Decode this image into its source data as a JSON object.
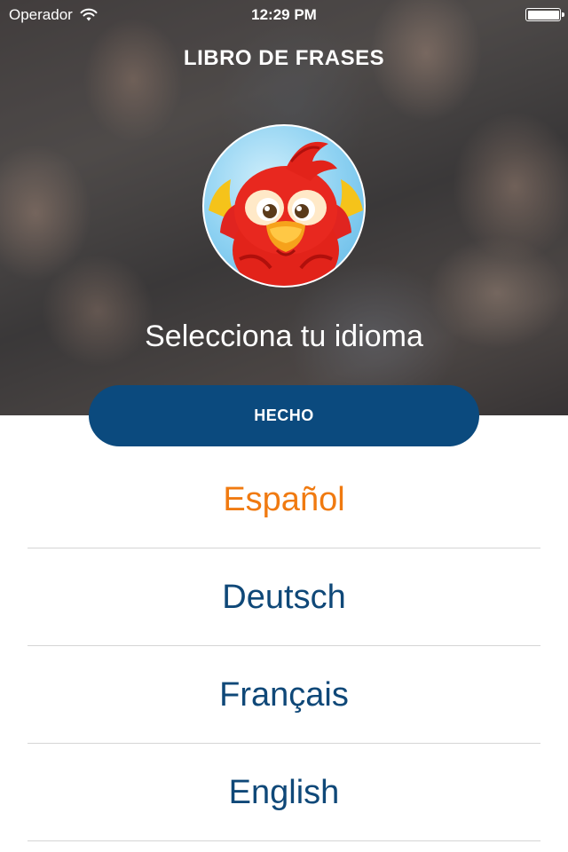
{
  "status_bar": {
    "carrier": "Operador",
    "time": "12:29 PM",
    "icons": [
      "wifi-icon",
      "battery-icon"
    ]
  },
  "header": {
    "title": "LIBRO DE FRASES",
    "subtitle": "Selecciona tu idioma"
  },
  "mascot": {
    "icon": "parrot-mascot-icon"
  },
  "done_button": {
    "label": "HECHO"
  },
  "languages": [
    {
      "label": "Español",
      "selected": true
    },
    {
      "label": "Deutsch",
      "selected": false
    },
    {
      "label": "Français",
      "selected": false
    },
    {
      "label": "English",
      "selected": false
    }
  ],
  "colors": {
    "primary_blue": "#0b4a7e",
    "selected_orange": "#f07a10",
    "language_text": "#0f4878",
    "divider": "#d5d5d5"
  }
}
